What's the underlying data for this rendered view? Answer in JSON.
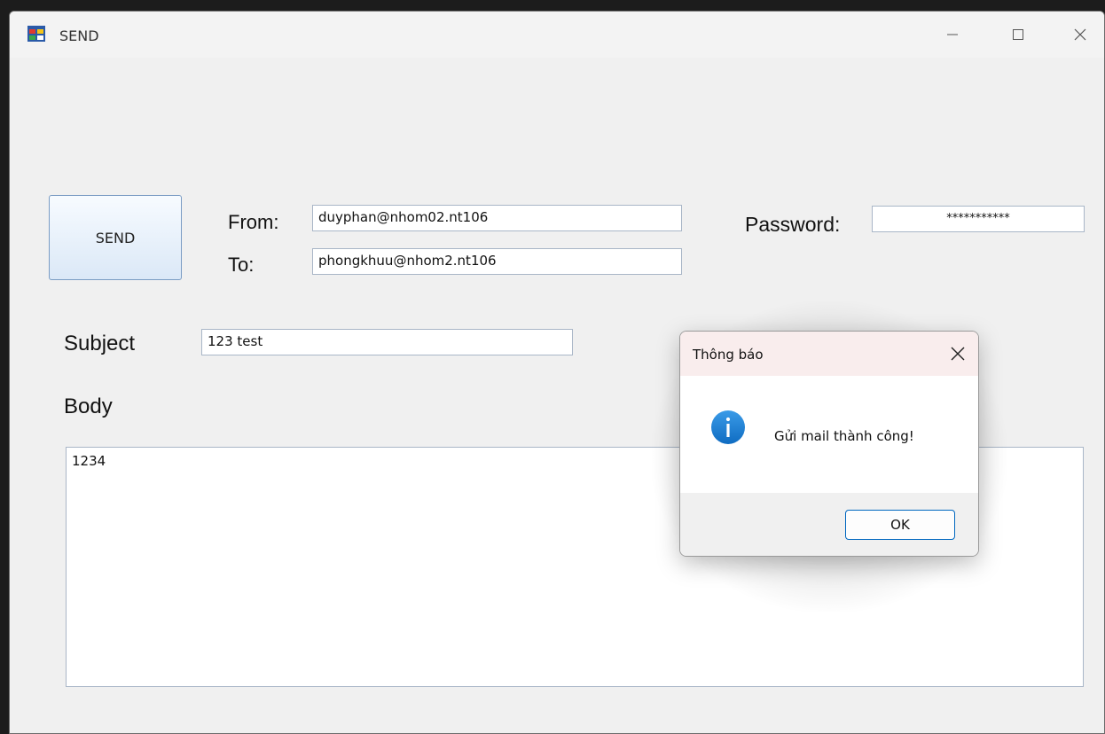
{
  "window": {
    "title": "SEND",
    "controls": {
      "minimize": "minimize-icon",
      "maximize": "maximize-icon",
      "close": "close-icon"
    }
  },
  "form": {
    "send_button_label": "SEND",
    "from_label": "From:",
    "from_value": "duyphan@nhom02.nt106",
    "to_label": "To:",
    "to_value": "phongkhuu@nhom2.nt106",
    "password_label": "Password:",
    "password_value": "***********",
    "subject_label": "Subject",
    "subject_value": "123 test",
    "body_label": "Body",
    "body_value": "1234"
  },
  "dialog": {
    "title": "Thông báo",
    "message": "Gửi mail thành công!",
    "ok_label": "OK",
    "icon": "info-icon"
  },
  "colors": {
    "accent": "#0067c0",
    "info_icon": "#1a7fd4"
  }
}
